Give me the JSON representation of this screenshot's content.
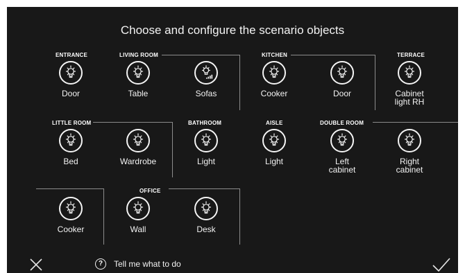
{
  "title": "Choose and configure the scenario objects",
  "sections": [
    {
      "id": "entrance",
      "label": "ENTRANCE"
    },
    {
      "id": "living",
      "label": "LIVING ROOM"
    },
    {
      "id": "kitchen",
      "label": "KITCHEN"
    },
    {
      "id": "terrace",
      "label": "TERRACE"
    },
    {
      "id": "little",
      "label": "LITTLE ROOM"
    },
    {
      "id": "bathroom",
      "label": "BATHROOM"
    },
    {
      "id": "aisle",
      "label": "AISLE"
    },
    {
      "id": "double",
      "label": "DOUBLE ROOM"
    },
    {
      "id": "office",
      "label": "OFFICE"
    }
  ],
  "items": [
    {
      "label": "Door",
      "icon": "light-bulb-icon"
    },
    {
      "label": "Table",
      "icon": "light-bulb-icon"
    },
    {
      "label": "Sofas",
      "icon": "dimmer-light-icon"
    },
    {
      "label": "Cooker",
      "icon": "light-bulb-icon"
    },
    {
      "label": "Door",
      "icon": "light-bulb-icon"
    },
    {
      "label": "Cabinet light RH",
      "icon": "light-bulb-icon"
    },
    {
      "label": "Bed",
      "icon": "light-bulb-icon"
    },
    {
      "label": "Wardrobe",
      "icon": "light-bulb-icon"
    },
    {
      "label": "Light",
      "icon": "light-bulb-icon"
    },
    {
      "label": "Light",
      "icon": "light-bulb-icon"
    },
    {
      "label": "Left cabinet",
      "icon": "light-bulb-icon"
    },
    {
      "label": "Right cabinet",
      "icon": "light-bulb-icon"
    },
    {
      "label": "Cooker",
      "icon": "light-bulb-icon"
    },
    {
      "label": "Wall",
      "icon": "light-bulb-icon"
    },
    {
      "label": "Desk",
      "icon": "light-bulb-icon"
    }
  ],
  "footer": {
    "help_text": "Tell me what to do",
    "help_icon": "question-circle-icon",
    "close_icon": "close-icon",
    "confirm_icon": "checkmark-icon"
  },
  "colors": {
    "background": "#181818",
    "foreground": "#ffffff",
    "divider": "#8c8c8c"
  }
}
